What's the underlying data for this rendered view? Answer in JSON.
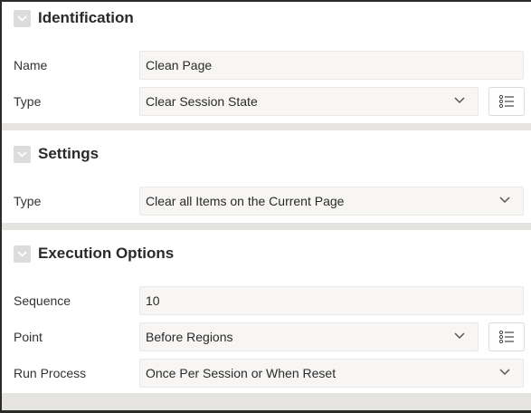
{
  "sections": {
    "identification": {
      "title": "Identification",
      "name_label": "Name",
      "name_value": "Clean Page",
      "type_label": "Type",
      "type_value": "Clear Session State"
    },
    "settings": {
      "title": "Settings",
      "type_label": "Type",
      "type_value": "Clear all Items on the Current Page"
    },
    "execution": {
      "title": "Execution Options",
      "sequence_label": "Sequence",
      "sequence_value": "10",
      "point_label": "Point",
      "point_value": "Before Regions",
      "run_label": "Run Process",
      "run_value": "Once Per Session or When Reset"
    }
  },
  "icons": {
    "collapse": "chevron-down-icon",
    "dropdown": "chevron-down-icon",
    "list": "list-icon"
  }
}
